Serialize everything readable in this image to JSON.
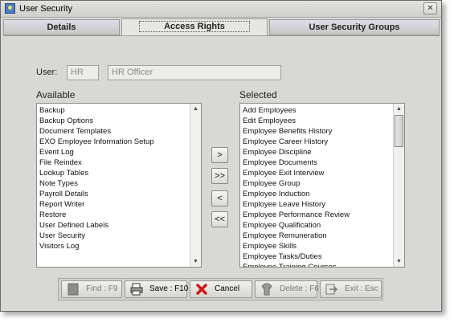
{
  "window": {
    "title": "User Security"
  },
  "tabs": [
    {
      "label": "Details"
    },
    {
      "label": "Access Rights"
    },
    {
      "label": "User Security Groups"
    }
  ],
  "user": {
    "label": "User:",
    "code": "HR",
    "name": "HR Officer"
  },
  "available": {
    "label": "Available",
    "items": [
      "Backup",
      "Backup Options",
      "Document Templates",
      "EXO Employee Information Setup",
      "Event Log",
      "File Reindex",
      "Lookup Tables",
      "Note Types",
      "Payroll Details",
      "Report Writer",
      "Restore",
      "User Defined Labels",
      "User Security",
      "Visitors Log"
    ]
  },
  "selected": {
    "label": "Selected",
    "items": [
      "Add Employees",
      "Edit Employees",
      "Employee Benefits History",
      "Employee Career History",
      "Employee Discipline",
      "Employee Documents",
      "Employee Exit Interview",
      "Employee Group",
      "Employee Induction",
      "Employee Leave History",
      "Employee Performance Review",
      "Employee Qualification",
      "Employee Remuneration",
      "Employee Skills",
      "Employee Tasks/Duties",
      "Employee Training Courses"
    ]
  },
  "move_buttons": {
    "add": ">",
    "add_all": ">>",
    "remove": "<",
    "remove_all": "<<"
  },
  "footer": {
    "find": "Find : F9",
    "save": "Save : F10",
    "cancel": "Cancel",
    "delete": "Delete : F6",
    "exit": "Exit : Esc"
  },
  "icons": {
    "find": "find-icon",
    "save": "printer-save-icon",
    "cancel": "red-x-icon",
    "delete": "shirt-delete-icon",
    "exit": "exit-arrow-icon"
  },
  "colors": {
    "cancel_red": "#d01818",
    "window_bg": "#d8d8d4"
  }
}
